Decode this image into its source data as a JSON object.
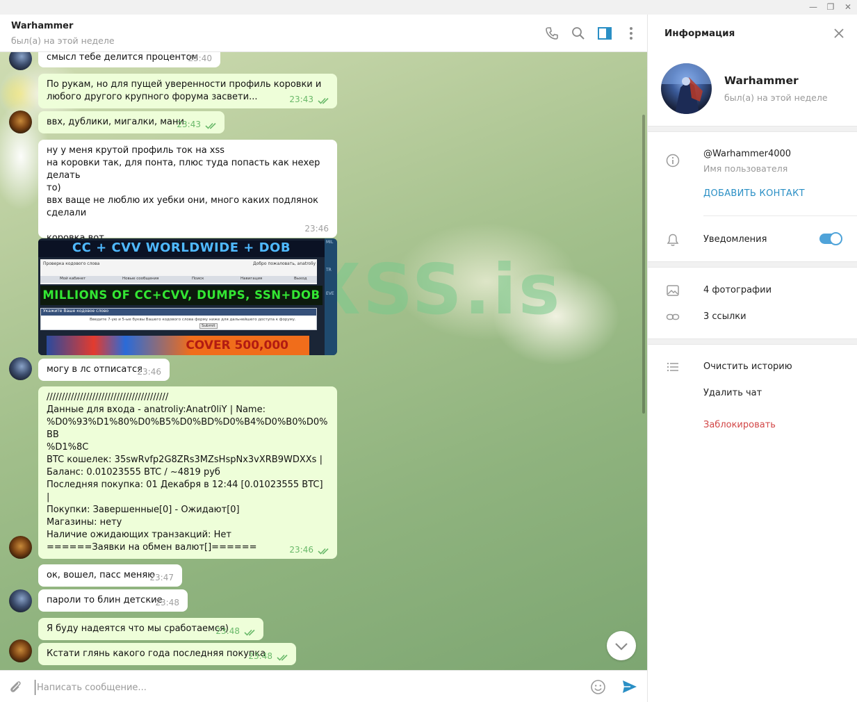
{
  "window": {
    "controls": [
      "—",
      "❐",
      "✕"
    ]
  },
  "chat": {
    "title": "Warhammer",
    "status": "был(а) на этой неделе",
    "composer_placeholder": "Написать сообщение..."
  },
  "messages": [
    {
      "side": "in",
      "text": "смысл тебе делится процентом",
      "time": "23:40"
    },
    {
      "side": "out",
      "text": "По рукам, но для пущей уверенности профиль коровки и\nлюбого другого крупного форума засвети...",
      "time": "23:43"
    },
    {
      "side": "out",
      "text": "ввх, дублики, мигалки, мани",
      "time": "23:43"
    },
    {
      "side": "in",
      "text": "ну у меня крутой профиль ток на xss\nна коровки так, для понта, плюс туда попасть как нехер делать\nто)\nввх ваще не люблю их уебки они, много каких подлянок\nсделали\n\nкоровка вот",
      "time": "23:46"
    },
    {
      "side": "in",
      "text": "могу в лс отписатся",
      "time": "23:46"
    },
    {
      "side": "out",
      "text": "////////////////////////////////////////\nДанные для входа - anatroliy:Anatr0liY | Name:\n%D0%93%D1%80%D0%B5%D0%BD%D0%B4%D0%B0%D0%BB\n%D1%8C\nBTC кошелек: 35swRvfp2G8ZRs3MZsHspNx3vXRB9WDXXs |\nБаланс: 0.01023555 BTC / ~4819 руб\nПоследняя покупка: 01 Декабря в 12:44 [0.01023555 BTC] |\nПокупки: Завершенные[0] - Ожидают[0]\nМагазины: нету\nНаличие ожидающих транзакций: Нет\n======Заявки на обмен валют[]======\n\n////////////////////////////////////////",
      "time": "23:46"
    },
    {
      "side": "in",
      "text": "ок, вошел, пасс меняю",
      "time": "23:47"
    },
    {
      "side": "in",
      "text": "пароли то блин детские",
      "time": "23:48"
    },
    {
      "side": "out",
      "text": "Я буду надеятся что мы сработаемся)",
      "time": "23:48"
    },
    {
      "side": "out",
      "text": "Кстати глянь какого года последняя покупка",
      "time": "23:48"
    }
  ],
  "media": {
    "banner_top": "CC + CVV WORLDWIDE + DOB",
    "banner_mid": "MILLIONS OF CC+CVV, DUMPS, SSN+DOB",
    "banner_bottom": "COVER 500,000",
    "forum_header": "Проверка кодового слова",
    "forum_welcome": "Добро пожаловать, anatroliy",
    "forum_tabs": [
      "Мой кабинет",
      "Новые сообщения",
      "Поиск",
      "Навигация",
      "Выход"
    ],
    "form_title": "Укажите Ваше кодовое слово",
    "form_hint": "Введите 7-ую и 5-ые буквы Вашего кодового слова форму ниже для дальнейшего доступа к форуму.",
    "form_submit": "Submit",
    "side_letters": [
      "MIL",
      "TR",
      "EVE"
    ]
  },
  "watermark": "XSS.is",
  "panel": {
    "title": "Информация",
    "name": "Warhammer",
    "status": "был(а) на этой неделе",
    "username": "@Warhammer4000",
    "username_label": "Имя пользователя",
    "add_contact": "ДОБАВИТЬ КОНТАКТ",
    "notifications": "Уведомления",
    "notifications_on": true,
    "photos": "4 фотографии",
    "links": "3 ссылки",
    "clear_history": "Очистить историю",
    "delete_chat": "Удалить чат",
    "block": "Заблокировать"
  },
  "colors": {
    "accent": "#4fa3d9",
    "link": "#2a8fc5",
    "danger": "#d24646",
    "outgoing_bubble": "#eefed9",
    "read_ticks": "#6ab96a"
  }
}
